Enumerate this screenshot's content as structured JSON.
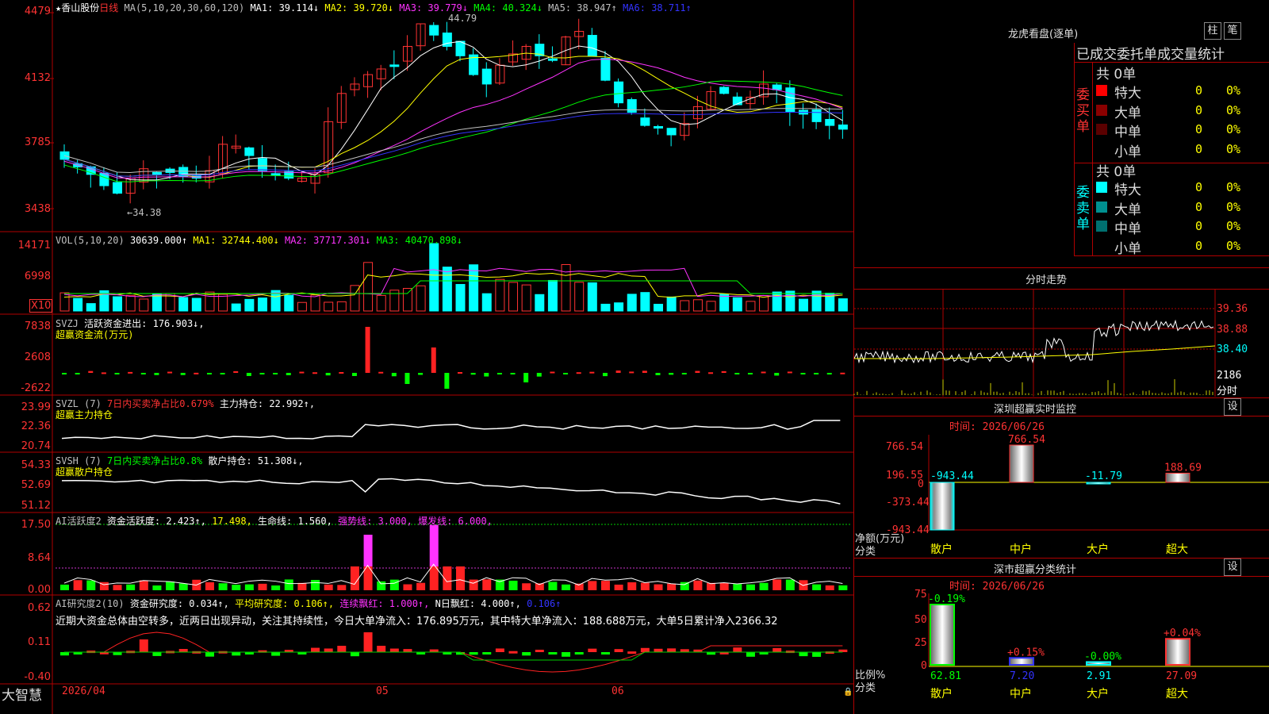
{
  "app": {
    "brand": "大智慧"
  },
  "chart_header": {
    "star": "★",
    "stock": "香山股份",
    "period": "日线",
    "ma_label": "MA(5,10,20,30,60,120)",
    "ma_items": [
      {
        "label": "MA1:",
        "value": "39.114↓",
        "color": "#ffffff"
      },
      {
        "label": "MA2:",
        "value": "39.720↓",
        "color": "#ffff00"
      },
      {
        "label": "MA3:",
        "value": "39.779↓",
        "color": "#ff33ff"
      },
      {
        "label": "MA4:",
        "value": "40.324↓",
        "color": "#00ff00"
      },
      {
        "label": "MA5:",
        "value": "38.947↑",
        "color": "#c0c0c0"
      },
      {
        "label": "MA6:",
        "value": "38.711↑",
        "color": "#3333ff"
      }
    ],
    "high_mark": "44.79",
    "low_mark": "←34.38"
  },
  "price_axis": [
    "4479",
    "4132",
    "3785",
    "3438"
  ],
  "volume_panel": {
    "label": "VOL(5,10,20)",
    "value": "30639.000↑",
    "items": [
      {
        "label": "MA1:",
        "value": "32744.400↓",
        "color": "#ffff00"
      },
      {
        "label": "MA2:",
        "value": "37717.301↓",
        "color": "#ff33ff"
      },
      {
        "label": "MA3:",
        "value": "40470.898↓",
        "color": "#00ff00"
      }
    ],
    "axis": [
      "14171",
      "6998"
    ],
    "unit": "X10"
  },
  "svzj_panel": {
    "label": "SVZJ",
    "desc": "活跃资金进出:",
    "value": "176.903↓,",
    "sub": "超赢资金流(万元)",
    "axis": [
      "7838",
      "2608",
      "-2622"
    ]
  },
  "svzl_panel": {
    "label": "SVZL (7)",
    "ratio": "7日内买卖净占比0.679%",
    "desc": "主力持仓:",
    "value": "22.992↑,",
    "sub": "超赢主力持仓",
    "axis": [
      "23.99",
      "22.36",
      "20.74"
    ]
  },
  "svsh_panel": {
    "label": "SVSH (7)",
    "ratio": "7日内买卖净占比0.8%",
    "desc": "散户持仓:",
    "value": "51.308↓,",
    "sub": "超赢散户持仓",
    "axis": [
      "54.33",
      "52.69",
      "51.12"
    ]
  },
  "ai_active_panel": {
    "label": "AI活跃度2",
    "desc": "资金活跃度:",
    "value": "2.423↑,",
    "v2": "17.498,",
    "life": "生命线: 1.560,",
    "strong": "强势线: 3.000,",
    "burst": "爆发线: 6.000,",
    "axis": [
      "17.50",
      "8.64",
      "0.00"
    ]
  },
  "ai_research_panel": {
    "label": "AI研究度2(10)",
    "desc": "资金研究度:",
    "value": "0.034↑,",
    "avg": "平均研究度: 0.106↑,",
    "streak": "连续飘红: 1.000↑,",
    "nday": "N日飘红: 4.000↑,",
    "last": "0.106↑",
    "note": "近期大资金总体由空转多，近两日出现异动，关注其持续性，今日大单净流入：176.895万元，其中特大单净流入：188.688万元，大单5日累计净入2366.32",
    "axis": [
      "0.62",
      "0.11",
      "-0.40"
    ]
  },
  "date_axis": [
    "2026/04",
    "05",
    "06"
  ],
  "right_panel": {
    "dragon_title": "龙虎看盘(逐单)",
    "btn_bar": "柱",
    "btn_pen": "笔",
    "trade_tabs": "已成交委托单成交量统计",
    "buy": {
      "side_label": "委买单",
      "total": "共 0单",
      "rows": [
        {
          "label": "特大",
          "count": "0",
          "pct": "0%",
          "color": "#ff0000"
        },
        {
          "label": "大单",
          "count": "0",
          "pct": "0%",
          "color": "#8b0000"
        },
        {
          "label": "中单",
          "count": "0",
          "pct": "0%",
          "color": "#5a0000"
        },
        {
          "label": "小单",
          "count": "0",
          "pct": "0%",
          "color": "#000000"
        }
      ]
    },
    "sell": {
      "side_label": "委卖单",
      "total": "共 0单",
      "rows": [
        {
          "label": "特大",
          "count": "0",
          "pct": "0%",
          "color": "#00ffff"
        },
        {
          "label": "大单",
          "count": "0",
          "pct": "0%",
          "color": "#009090"
        },
        {
          "label": "中单",
          "count": "0",
          "pct": "0%",
          "color": "#007070"
        },
        {
          "label": "小单",
          "count": "0",
          "pct": "0%",
          "color": "#000000"
        }
      ]
    },
    "intraday_title": "分时走势",
    "intraday_axis": [
      "39.36",
      "38.88",
      "38.40"
    ],
    "intraday_vol": "2186",
    "intraday_vol_label": "分时",
    "sz_monitor": {
      "title": "深圳超赢实时监控",
      "settings": "设",
      "time": "时间: 2026/06/26",
      "axis": [
        "766.54",
        "196.55",
        "0",
        "-373.44",
        "-943.44"
      ],
      "bars": [
        {
          "name": "散户",
          "value": -943.44,
          "label": "-943.44"
        },
        {
          "name": "中户",
          "value": 766.54,
          "label": "766.54"
        },
        {
          "name": "大户",
          "value": -11.79,
          "label": "-11.79"
        },
        {
          "name": "超大",
          "value": 188.69,
          "label": "188.69"
        }
      ],
      "y_label": "净额(万元)",
      "x_label": "分类"
    },
    "sz_stats": {
      "title": "深市超赢分类统计",
      "settings": "设",
      "time": "时间: 2026/06/26",
      "axis": [
        "75",
        "50",
        "25",
        "0"
      ],
      "bars": [
        {
          "name": "散户",
          "value": 62.81,
          "label": "62.81",
          "change": "-0.19%"
        },
        {
          "name": "中户",
          "value": 7.2,
          "label": "7.20",
          "change": "+0.15%"
        },
        {
          "name": "大户",
          "value": 2.91,
          "label": "2.91",
          "change": "-0.00%"
        },
        {
          "name": "超大",
          "value": 27.09,
          "label": "27.09",
          "change": "+0.04%"
        }
      ],
      "y_label": "比例%",
      "x_label": "分类"
    }
  }
}
